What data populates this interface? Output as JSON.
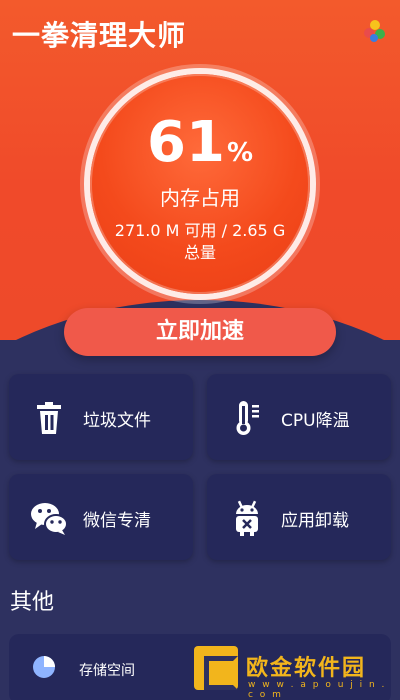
{
  "app": {
    "title": "一拳清理大师"
  },
  "memory": {
    "percent": "61",
    "percent_sign": "%",
    "label": "内存占用",
    "detail": "271.0 M 可用 / 2.65 G 总量"
  },
  "boost": {
    "label": "立即加速"
  },
  "features": [
    {
      "label": "垃圾文件",
      "icon": "trash-icon"
    },
    {
      "label": "CPU降温",
      "icon": "thermometer-icon"
    },
    {
      "label": "微信专清",
      "icon": "wechat-icon"
    },
    {
      "label": "应用卸载",
      "icon": "android-icon"
    }
  ],
  "others": {
    "title": "其他",
    "items": [
      {
        "label": "存储空间",
        "icon": "pie-chart-icon"
      }
    ]
  },
  "watermark": {
    "text": "欧金软件园",
    "url": "w w w . a p o u j i n . c o m"
  },
  "colors": {
    "hero_orange": "#f04a2a",
    "gauge_red": "#f44a1c",
    "boost_button": "#f0594a",
    "background_navy": "#2e3160",
    "card_navy": "#25285a",
    "watermark_yellow": "#f2b51c"
  }
}
